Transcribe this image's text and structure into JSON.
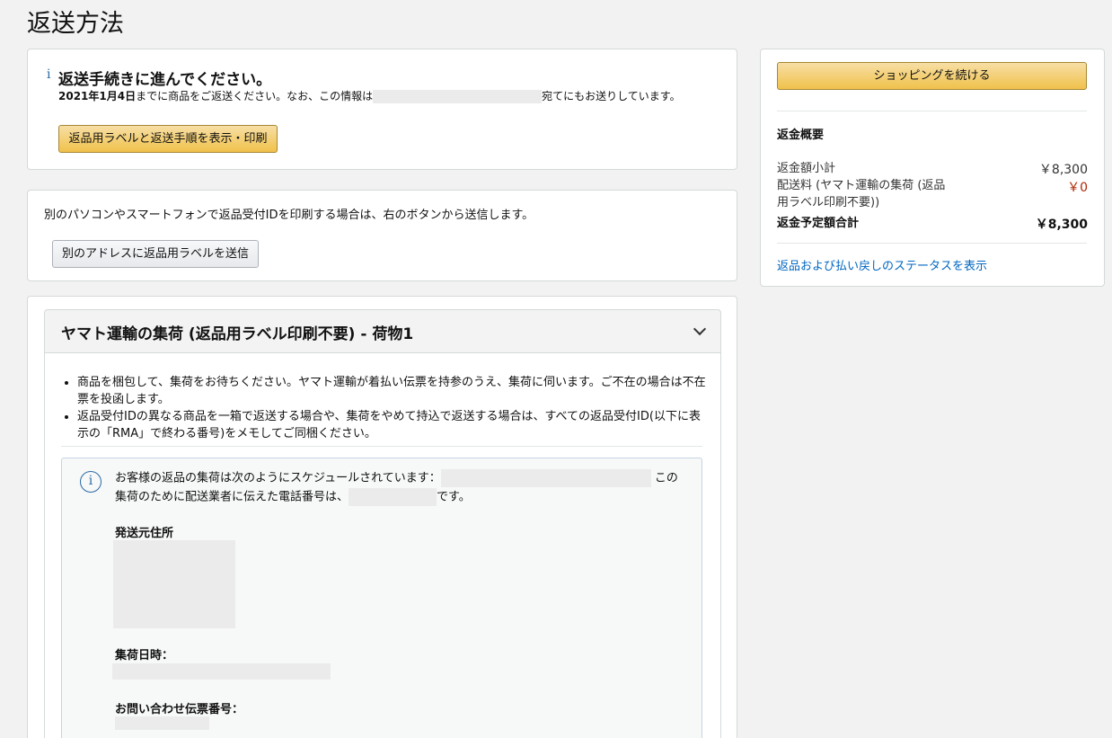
{
  "page": {
    "title": "返送方法"
  },
  "box1": {
    "icon": "info-icon",
    "heading": "返送手続きに進んでください。",
    "date": "2021年1月4日",
    "text_before": "までに商品をご返送ください。なお、この情報は",
    "text_after": "宛てにもお送りしています。",
    "button_label": "返品用ラベルと返送手順を表示・印刷"
  },
  "box2": {
    "text": "別のパソコンやスマートフォンで返品受付IDを印刷する場合は、右のボタンから送信します。",
    "button_label": "別のアドレスに返品用ラベルを送信"
  },
  "shipment": {
    "title": "ヤマト運輸の集荷 (返品用ラベル印刷不要) - 荷物1",
    "bullets": [
      "商品を梱包して、集荷をお待ちください。ヤマト運輸が着払い伝票を持参のうえ、集荷に伺います。ご不在の場合は不在票を投函します。",
      "返品受付IDの異なる商品を一箱で返送する場合や、集荷をやめて持込で返送する場合は、すべての返品受付ID(以下に表示の「RMA」で終わる番号)をメモしてご同梱ください。"
    ],
    "notice": {
      "text_1": "お客様の返品の集荷は次のようにスケジュールされています：",
      "text_2": "この",
      "text_3": "集荷のために配送業者に伝えた電話番号は、",
      "text_4": "です。",
      "label_address": "発送元住所",
      "label_pickup": "集荷日時：",
      "label_tracking": "お問い合わせ伝票番号："
    }
  },
  "sidebar": {
    "continue_button": "ショッピングを続ける",
    "heading": "返金概要",
    "rows": [
      {
        "label": "返金額小計",
        "value": "￥8,300"
      },
      {
        "label": "配送料 (ヤマト運輸の集荷 (返品",
        "label2": "用ラベル印刷不要))",
        "value": "￥0"
      },
      {
        "label": "返金予定額合計",
        "value": "￥8,300"
      }
    ],
    "link": "返品および払い戻しのステータスを表示"
  },
  "colors": {
    "accent_link": "#0066c0",
    "price_red": "#b12704",
    "button_yellow": "#f0c14b"
  }
}
